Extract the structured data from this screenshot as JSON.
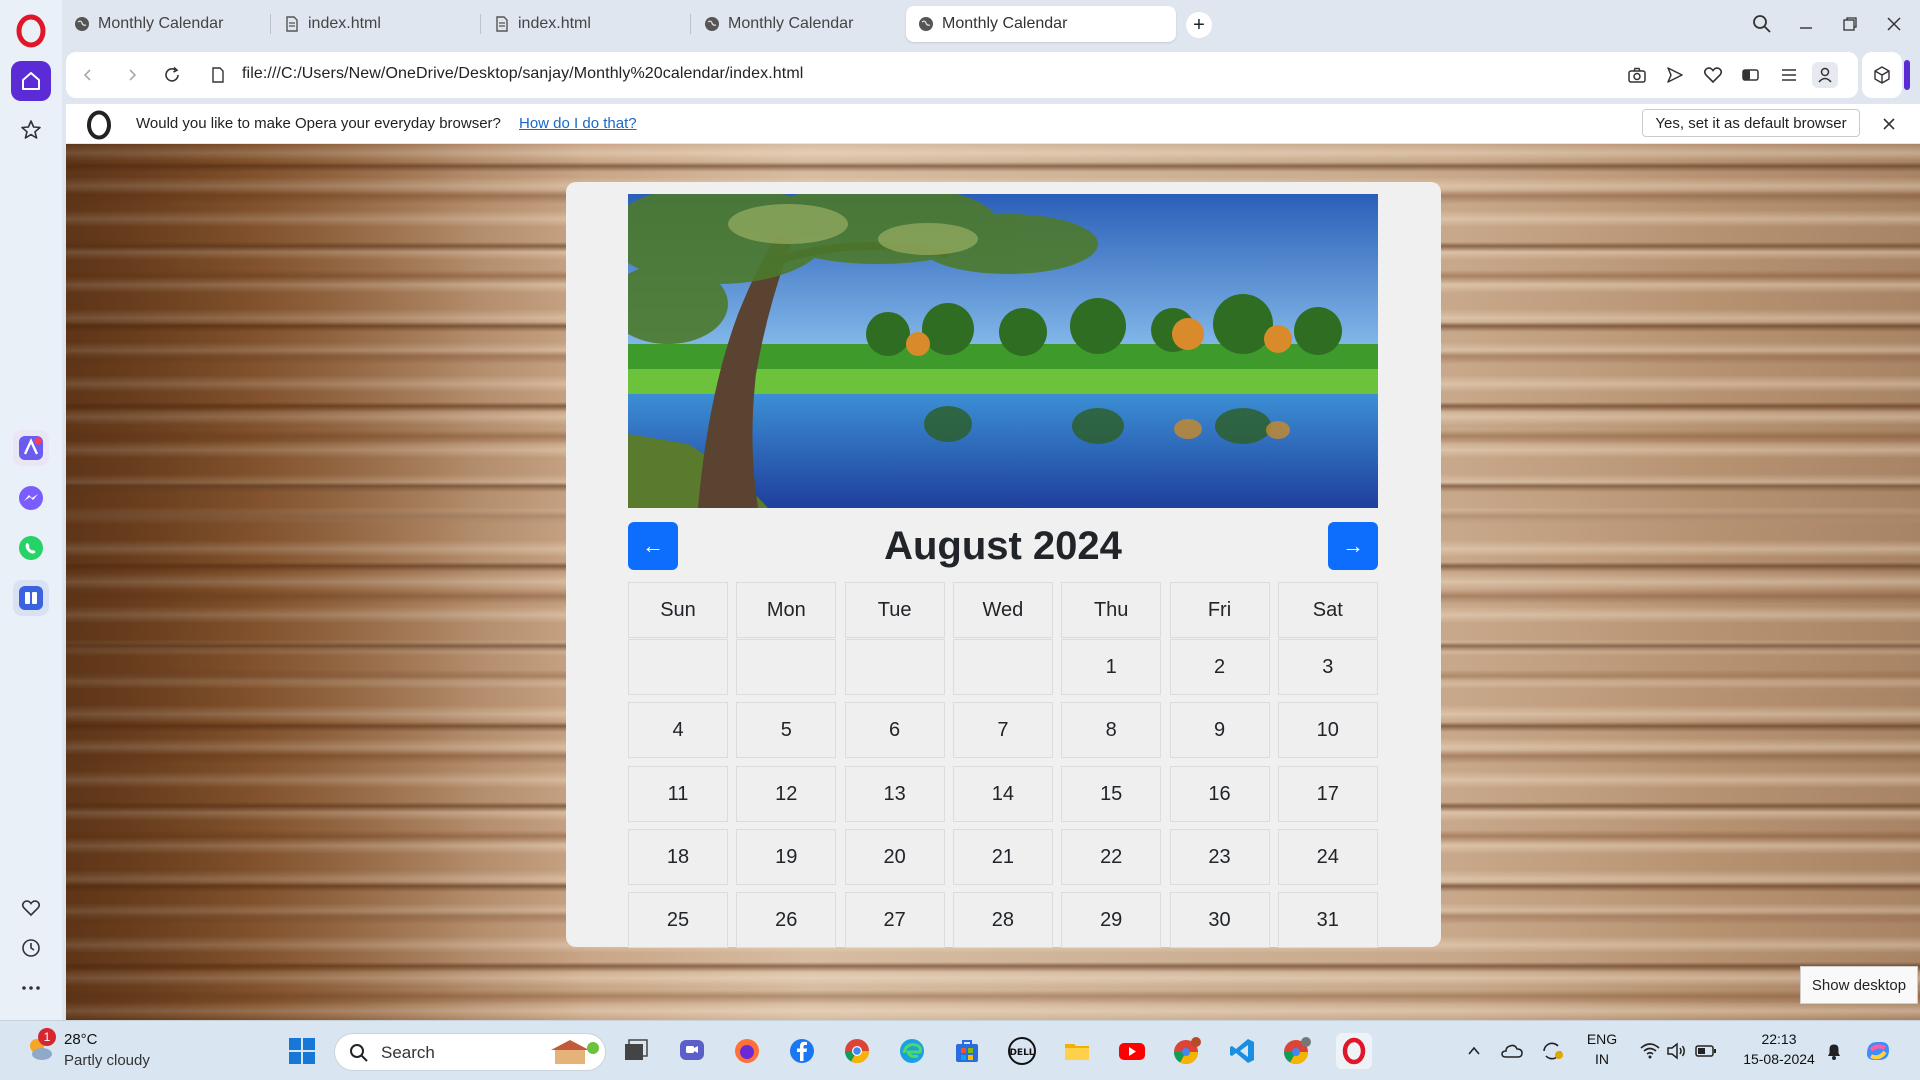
{
  "browser": {
    "tabs": [
      {
        "label": "Monthly Calendar",
        "icon": "globe-icon",
        "active": false
      },
      {
        "label": "index.html",
        "icon": "file-icon",
        "active": false
      },
      {
        "label": "index.html",
        "icon": "file-icon",
        "active": false
      },
      {
        "label": "Monthly Calendar",
        "icon": "globe-icon",
        "active": false
      },
      {
        "label": "Monthly Calendar",
        "icon": "globe-icon",
        "active": true
      }
    ],
    "new_tab": "+",
    "url": "file:///C:/Users/New/OneDrive/Desktop/sanjay/Monthly%20calendar/index.html"
  },
  "infobar": {
    "message": "Would you like to make Opera your everyday browser?",
    "link": "How do I do that?",
    "button": "Yes, set it as default browser"
  },
  "calendar": {
    "prev_label": "←",
    "next_label": "→",
    "title": "August 2024",
    "weekdays": [
      "Sun",
      "Mon",
      "Tue",
      "Wed",
      "Thu",
      "Fri",
      "Sat"
    ],
    "weeks": [
      [
        "",
        "",
        "",
        "",
        "1",
        "2",
        "3"
      ],
      [
        "4",
        "5",
        "6",
        "7",
        "8",
        "9",
        "10"
      ],
      [
        "11",
        "12",
        "13",
        "14",
        "15",
        "16",
        "17"
      ],
      [
        "18",
        "19",
        "20",
        "21",
        "22",
        "23",
        "24"
      ],
      [
        "25",
        "26",
        "27",
        "28",
        "29",
        "30",
        "31"
      ]
    ]
  },
  "tooltip": "Show desktop",
  "taskbar": {
    "weather": {
      "temp": "28°C",
      "desc": "Partly cloudy",
      "badge": "1"
    },
    "search_placeholder": "Search",
    "lang_top": "ENG",
    "lang_bottom": "IN",
    "time": "22:13",
    "date": "15-08-2024"
  },
  "colors": {
    "accent": "#0d6efd",
    "opera_red": "#e0162b",
    "sidebar_active": "#5b2bd6"
  }
}
